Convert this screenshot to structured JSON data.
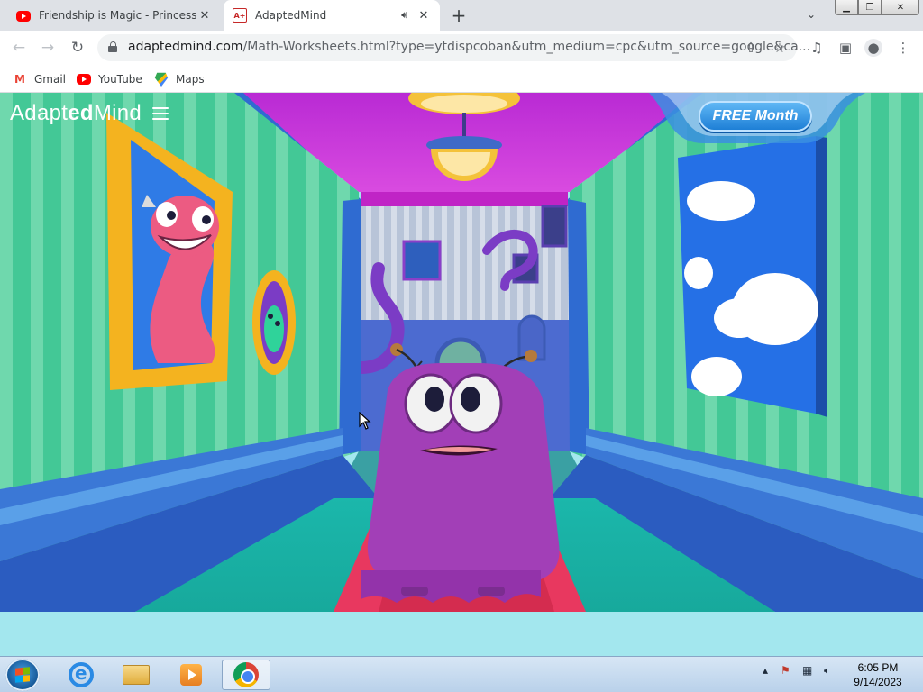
{
  "browser": {
    "tabs": [
      {
        "title": "Friendship is Magic - Princess Ca",
        "favicon": "youtube-icon",
        "active": false
      },
      {
        "title": "AdaptedMind",
        "favicon": "adaptedmind-icon",
        "active": true,
        "audio": "speaker-icon"
      }
    ],
    "new_tab_label": "+",
    "address": {
      "domain": "adaptedmind.com",
      "path": "/Math-Worksheets.html?type=ytdispcoban&utm_medium=cpc&utm_source=google&ca..."
    },
    "bookmarks": [
      {
        "label": "Gmail",
        "icon": "gmail-icon"
      },
      {
        "label": "YouTube",
        "icon": "youtube-icon"
      },
      {
        "label": "Maps",
        "icon": "maps-icon"
      }
    ]
  },
  "page": {
    "logo_prefix": "Adapt",
    "logo_bold": "ed",
    "logo_suffix": "Mind",
    "free_button": "FREE Month",
    "colors": {
      "wall_green": "#3fc79a",
      "wall_blue": "#2a62c8",
      "ceiling": "#c02ed8",
      "monster": "#a23fb7",
      "carpet": "#e8385f",
      "footer": "#a3e7ee"
    }
  },
  "taskbar": {
    "apps": [
      "internet-explorer-icon",
      "file-explorer-icon",
      "media-player-icon",
      "chrome-icon"
    ],
    "time": "6:05 PM",
    "date": "9/14/2023"
  }
}
